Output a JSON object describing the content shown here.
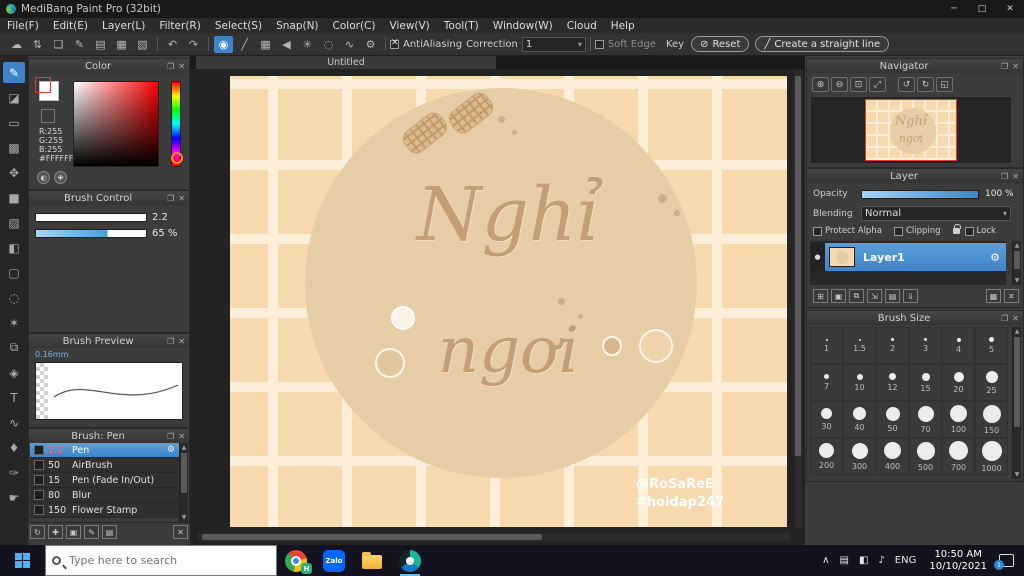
{
  "window": {
    "title": "MediBang Paint Pro (32bit)"
  },
  "menu": {
    "items": [
      "File(F)",
      "Edit(E)",
      "Layer(L)",
      "Filter(R)",
      "Select(S)",
      "Snap(N)",
      "Color(C)",
      "View(V)",
      "Tool(T)",
      "Window(W)",
      "Cloud",
      "Help"
    ]
  },
  "toolbar": {
    "antialiasing_label": "AntiAliasing",
    "correction_label": "Correction",
    "correction_value": "1",
    "soft_edge_label": "Soft Edge",
    "key_label": "Key",
    "reset_label": "Reset",
    "straight_line_label": "Create a straight line"
  },
  "color_panel": {
    "title": "Color",
    "r": "R:255",
    "g": "G:255",
    "b": "B:255",
    "hex": "#FFFFFF"
  },
  "brush_control": {
    "title": "Brush Control",
    "size_value": "2.2",
    "opacity_value": "65 %"
  },
  "brush_preview": {
    "title": "Brush Preview",
    "size_label": "0.16mm"
  },
  "brush_list": {
    "title": "Brush: Pen",
    "items": [
      {
        "size": "2.2",
        "name": "Pen"
      },
      {
        "size": "50",
        "name": "AirBrush"
      },
      {
        "size": "15",
        "name": "Pen (Fade In/Out)"
      },
      {
        "size": "80",
        "name": "Blur"
      },
      {
        "size": "150",
        "name": "Flower Stamp"
      }
    ]
  },
  "canvas": {
    "tab_title": "Untitled",
    "artwork_line1": "Nghỉ",
    "artwork_line2": "ngơi",
    "credit_line1": "@RoSaReE",
    "credit_line2": "#hoidap247"
  },
  "navigator": {
    "title": "Navigator"
  },
  "layer_panel": {
    "title": "Layer",
    "opacity_label": "Opacity",
    "opacity_value": "100 %",
    "blending_label": "Blending",
    "blending_value": "Normal",
    "protect_alpha_label": "Protect Alpha",
    "clipping_label": "Clipping",
    "lock_label": "Lock",
    "layer_name": "Layer1"
  },
  "brush_size_panel": {
    "title": "Brush Size",
    "sizes": [
      "1",
      "1.5",
      "2",
      "3",
      "4",
      "5",
      "7",
      "10",
      "12",
      "15",
      "20",
      "25",
      "30",
      "40",
      "50",
      "70",
      "100",
      "150",
      "200",
      "300",
      "400",
      "500",
      "700",
      "1000"
    ]
  },
  "taskbar": {
    "search_placeholder": "Type here to search",
    "zalo_label": "Zalo",
    "chrome_badge": "H",
    "language": "ENG",
    "time": "10:50 AM",
    "date": "10/10/2021",
    "notification_count": "1"
  },
  "colors": {
    "accent": "#3f84c9",
    "canvas_bg": "#f8d9ae",
    "grid_line": "#fdeeda",
    "circle": "#e7cda5",
    "artwork_text": "#c49f73"
  }
}
